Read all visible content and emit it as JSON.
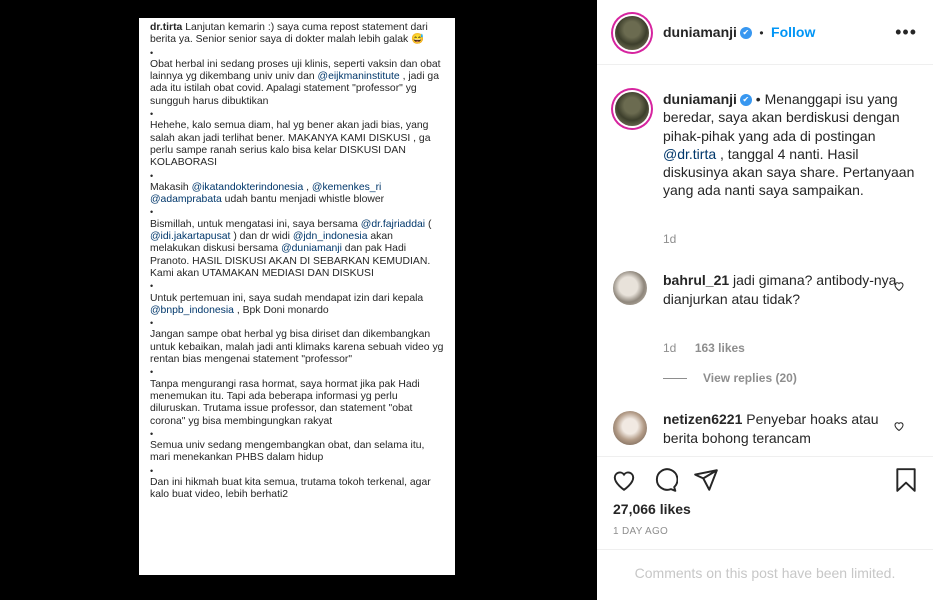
{
  "post_image": {
    "lines": [
      {
        "type": "text",
        "user": "dr.tirta",
        "text": " Lanjutan kemarin :) saya cuma repost statement dari berita ya. Senior senior saya di dokter malah lebih galak 😅"
      },
      {
        "type": "dot",
        "text": "•"
      },
      {
        "type": "text",
        "text": "Obat herbal ini sedang proses uji klinis, seperti vaksin dan obat lainnya yg dikembang univ univ dan "
      },
      {
        "type": "dot",
        "text": "•"
      },
      {
        "type": "text",
        "text": "Hehehe, kalo semua diam, hal yg bener akan jadi bias, yang salah akan jadi terlihat bener. MAKANYA KAMI DISKUSI , ga perlu sampe ranah serius kalo bisa kelar DISKUSI DAN KOLABORASI"
      },
      {
        "type": "dot",
        "text": "•"
      },
      {
        "type": "dot",
        "text": "•"
      },
      {
        "type": "dot",
        "text": "•"
      },
      {
        "type": "dot",
        "text": "•"
      },
      {
        "type": "text",
        "text": "Jangan sampe obat herbal yg bisa diriset dan dikembangkan untuk kebaikan, malah jadi anti klimaks karena sebuah video yg rentan bias mengenai statement \"professor\""
      },
      {
        "type": "dot",
        "text": "•"
      },
      {
        "type": "text",
        "text": "Tanpa mengurangi rasa hormat, saya hormat jika pak Hadi menemukan itu. Tapi ada beberapa informasi yg perlu diluruskan. Trutama issue professor, dan statement \"obat corona\" yg bisa membingungkan rakyat"
      },
      {
        "type": "dot",
        "text": "•"
      },
      {
        "type": "text",
        "text": "Semua univ sedang mengembangkan obat, dan selama itu, mari menekankan PHBS dalam hidup"
      },
      {
        "type": "dot",
        "text": "•"
      },
      {
        "type": "text",
        "text": "Dan ini hikmah buat kita semua, trutama tokoh terkenal, agar kalo buat video, lebih berhati2"
      }
    ],
    "p2_mention": "@eijkmaninstitute",
    "p2_rest": " , jadi ga ada itu istilah obat covid. Apalagi statement \"professor\" yg sungguh harus dibuktikan",
    "p4_a": "Makasih ",
    "p4_m1": "@ikatandokterindonesia",
    "p4_b": " ,  ",
    "p4_m2": "@kemenkes_ri",
    "p4_m3": "@adamprabata",
    "p4_c": " udah bantu menjadi whistle blower",
    "p5_a": "Bismillah, untuk mengatasi ini, saya bersama ",
    "p5_m1": "@dr.fajriaddai",
    "p5_b": " ( ",
    "p5_m2": "@idi.jakartapusat",
    "p5_c": " ) dan dr widi  ",
    "p5_m3": "@jdn_indonesia",
    "p5_d": " akan melakukan diskusi bersama ",
    "p5_m4": "@duniamanji",
    "p5_e": " dan pak Hadi Pranoto. HASIL DISKUSI AKAN DI SEBARKAN KEMUDIAN. Kami akan UTAMAKAN MEDIASI DAN DISKUSI",
    "p6_a": "Untuk pertemuan ini, saya sudah mendapat izin dari kepala ",
    "p6_m1": "@bnpb_indonesia",
    "p6_b": " , Bpk Doni monardo"
  },
  "header": {
    "username": "duniamanji",
    "verified_glyph": "✔",
    "separator": "•",
    "follow_label": "Follow",
    "more_label": "•••"
  },
  "caption": {
    "username": "duniamanji",
    "text_a": " • Menanggapi isu yang beredar, saya akan berdiskusi dengan pihak-pihak yang ada di postingan ",
    "mention": "@dr.tirta",
    "text_b": " , tanggal 4 nanti. Hasil diskusinya akan saya share. Pertanyaan yang ada nanti saya sampaikan.",
    "time": "1d"
  },
  "comments": [
    {
      "username": "bahrul_21",
      "text": " jadi gimana? antibody-nya dianjurkan atau tidak?",
      "time": "1d",
      "likes": "163 likes",
      "view_replies": "View replies (20)"
    },
    {
      "username": "netizen6221",
      "text": " Penyebar hoaks atau berita bohong terancam"
    }
  ],
  "actions": {
    "likes": "27,066 likes",
    "date": "1 DAY AGO",
    "icons": [
      "heart-icon",
      "comment-icon",
      "share-icon",
      "bookmark-icon"
    ]
  },
  "footer": {
    "limited_text": "Comments on this post have been limited."
  },
  "colors": {
    "link": "#00376b",
    "follow": "#0095f6",
    "muted": "#8e8e8e"
  }
}
